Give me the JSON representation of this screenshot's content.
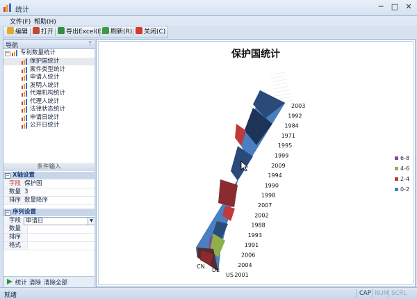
{
  "window": {
    "title": "统计",
    "min_glyph": "─",
    "max_glyph": "□",
    "close_glyph": "✕"
  },
  "menu": [
    "文件(F)",
    "帮助(H)"
  ],
  "toolbar": {
    "edit": "编辑",
    "open": "打开",
    "export_excel": "导出Excel(E)",
    "refresh": "刷新(R)",
    "close": "关闭(C)"
  },
  "nav": {
    "header": "导航",
    "pin_glyph": "ᛘ",
    "root": "专利数量统计",
    "items": [
      "保护国统计",
      "案件类型统计",
      "申请人统计",
      "发明人统计",
      "代理机构统计",
      "代理人统计",
      "法律状态统计",
      "申请日统计",
      "公开日统计"
    ],
    "selected_index": 0
  },
  "conditions": {
    "header": "条件输入",
    "x_axis": {
      "title": "X轴设置",
      "rows": [
        {
          "key": "字段",
          "value": "保护国"
        },
        {
          "key": "数量",
          "value": "3"
        },
        {
          "key": "排序",
          "value": "数量降序"
        }
      ]
    },
    "series": {
      "title": "序列设置",
      "rows": [
        {
          "key": "字段",
          "value": "申请日"
        },
        {
          "key": "数量",
          "value": ""
        },
        {
          "key": "排序",
          "value": ""
        },
        {
          "key": "格式",
          "value": ""
        }
      ]
    }
  },
  "bottom_actions": {
    "stat": "统计",
    "clear": "清除",
    "clear_all": "清除全部"
  },
  "chart_data": {
    "type": "area",
    "title": "保护国统计",
    "categories": [
      "CN",
      "DE",
      "US"
    ],
    "depth_categories": [
      "2003",
      "1992",
      "1984",
      "1971",
      "1995",
      "1999",
      "2009",
      "1994",
      "1990",
      "1998",
      "2007",
      "2002",
      "1988",
      "1993",
      "1991",
      "2006",
      "2004",
      "2001"
    ],
    "legend": [
      "6-8",
      "4-6",
      "2-4",
      "0-2"
    ],
    "legend_colors": [
      "#7b4d9e",
      "#8db04a",
      "#c0393b",
      "#4a7fc1"
    ],
    "ylabel": "",
    "grid": true,
    "legend_position": "right"
  },
  "status": {
    "text": "就绪",
    "cap": "CAP",
    "num": "NUM",
    "scrl": "SCRL"
  }
}
